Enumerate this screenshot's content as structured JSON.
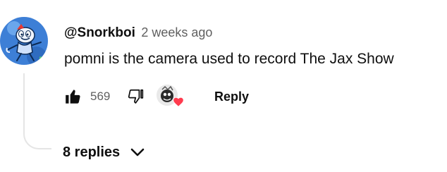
{
  "comment": {
    "author": "@Snorkboi",
    "timestamp": "2 weeks ago",
    "text": "pomni is the camera used to record The Jax Show",
    "like_count": "569",
    "reply_label": "Reply",
    "replies_label": "8 replies"
  },
  "icons": {
    "like": "thumbs-up-icon",
    "dislike": "thumbs-down-icon",
    "creator_heart": "heart-icon",
    "expand": "chevron-down-icon"
  },
  "colors": {
    "primary_text": "#0f0f0f",
    "secondary_text": "#606060",
    "heart": "#ff3b4e",
    "avatar_bg": "#3d7fd6",
    "thread_line": "#e5e5e5"
  }
}
